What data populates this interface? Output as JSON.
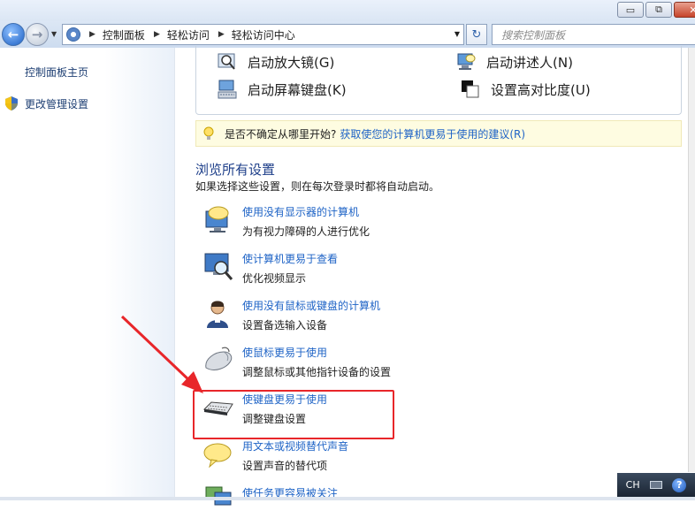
{
  "window": {
    "minimize_label": "▭",
    "maximize_label": "⧉",
    "close_label": "✕"
  },
  "address": {
    "crumbs": [
      "控制面板",
      "轻松访问",
      "轻松访问中心"
    ],
    "search_placeholder": "搜索控制面板"
  },
  "sidebar": {
    "items": [
      {
        "label": "控制面板主页"
      },
      {
        "label": "更改管理设置",
        "icon": "uac-shield-icon"
      }
    ]
  },
  "quick_tools": [
    {
      "label": "启动放大镜(G)",
      "icon": "magnifier-icon"
    },
    {
      "label": "启动讲述人(N)",
      "icon": "narrator-icon"
    },
    {
      "label": "启动屏幕键盘(K)",
      "icon": "onscreen-keyboard-icon"
    },
    {
      "label": "设置高对比度(U)",
      "icon": "high-contrast-icon"
    }
  ],
  "hint": {
    "question": "是否不确定从哪里开始?",
    "link": "获取使您的计算机更易于使用的建议(R)"
  },
  "section": {
    "title": "浏览所有设置",
    "description": "如果选择这些设置，则在每次登录时都将自动启动。"
  },
  "settings": [
    {
      "title": "使用没有显示器的计算机",
      "subtitle": "为有视力障碍的人进行优化",
      "icon": "monitor-speech-icon"
    },
    {
      "title": "使计算机更易于查看",
      "subtitle": "优化视频显示",
      "icon": "monitor-magnifier-icon"
    },
    {
      "title": "使用没有鼠标或键盘的计算机",
      "subtitle": "设置备选输入设备",
      "icon": "user-icon"
    },
    {
      "title": "使鼠标更易于使用",
      "subtitle": "调整鼠标或其他指针设备的设置",
      "icon": "mouse-icon"
    },
    {
      "title": "使键盘更易于使用",
      "subtitle": "调整键盘设置",
      "icon": "keyboard-icon"
    },
    {
      "title": "用文本或视频替代声音",
      "subtitle": "设置声音的替代项",
      "icon": "speech-bubble-icon"
    },
    {
      "title": "使任务更容易被关注",
      "subtitle": "",
      "icon": "task-icon"
    }
  ],
  "tray": {
    "language": "CH",
    "help_label": "?"
  },
  "colors": {
    "link": "#1e63c6",
    "annotation": "#e8262a"
  }
}
